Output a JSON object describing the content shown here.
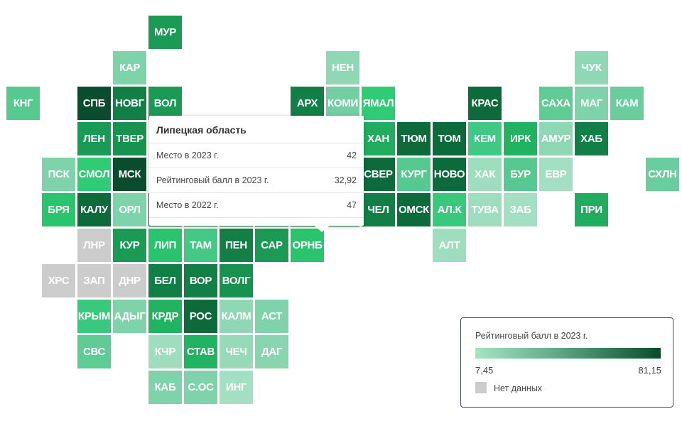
{
  "map": {
    "no_data_color": "#cccccc",
    "tiles": [
      {
        "label": "МУР",
        "color": "#1a9a55"
      },
      {
        "label": "КАР",
        "color": "#7fd3ab"
      },
      {
        "label": "НЕН",
        "color": "#8fd8b5"
      },
      {
        "label": "ЧУК",
        "color": "#8fd8b5"
      },
      {
        "label": "КНГ",
        "color": "#55c98f"
      },
      {
        "label": "СПБ",
        "color": "#0a4d2e"
      },
      {
        "label": "НОВГ",
        "color": "#128046"
      },
      {
        "label": "ВОЛ",
        "color": "#1a9a55"
      },
      {
        "label": "АРХ",
        "color": "#128046"
      },
      {
        "label": "КОМИ",
        "color": "#72cfa2"
      },
      {
        "label": "ЯМАЛ",
        "color": "#2fcc75"
      },
      {
        "label": "КРАС",
        "color": "#0d6a3b"
      },
      {
        "label": "САХА",
        "color": "#5fcb95"
      },
      {
        "label": "МАГ",
        "color": "#7fd3ab"
      },
      {
        "label": "КАМ",
        "color": "#6acd9d"
      },
      {
        "label": "ЛЕН",
        "color": "#1a9a55"
      },
      {
        "label": "ТВЕР",
        "color": "#18934f"
      },
      {
        "label": "ХАН",
        "color": "#21ad5f"
      },
      {
        "label": "ТЮМ",
        "color": "#0d6a3b"
      },
      {
        "label": "ТОМ",
        "color": "#0d6a3b"
      },
      {
        "label": "КЕМ",
        "color": "#40c985"
      },
      {
        "label": "ИРК",
        "color": "#21b362"
      },
      {
        "label": "АМУР",
        "color": "#8fd8b5"
      },
      {
        "label": "ХАБ",
        "color": "#128046"
      },
      {
        "label": "ПСК",
        "color": "#7fd3ab"
      },
      {
        "label": "СМОЛ",
        "color": "#2fcc75"
      },
      {
        "label": "МСК",
        "color": "#0a4d2e"
      },
      {
        "label": "СВЕР",
        "color": "#0d6a3b"
      },
      {
        "label": "КУРГ",
        "color": "#55c98f"
      },
      {
        "label": "НОВО",
        "color": "#0d6a3b"
      },
      {
        "label": "ХАК",
        "color": "#9edebf"
      },
      {
        "label": "БУР",
        "color": "#55c98f"
      },
      {
        "label": "ЕВР",
        "color": "#a3dfc2"
      },
      {
        "label": "СХЛН",
        "color": "#6acd9d"
      },
      {
        "label": "БРЯ",
        "color": "#29c46d"
      },
      {
        "label": "КАЛУ",
        "color": "#0d6a3b"
      },
      {
        "label": "ОРЛ",
        "color": "#7fd3ab"
      },
      {
        "label": "",
        "color": "#0e6e3e"
      },
      {
        "label": "",
        "color": "#128046"
      },
      {
        "label": "",
        "color": "#128046"
      },
      {
        "label": "",
        "color": "#128046"
      },
      {
        "label": "",
        "color": "#0e6e3e"
      },
      {
        "label": "",
        "color": "#128046"
      },
      {
        "label": "ЧЕЛ",
        "color": "#128046"
      },
      {
        "label": "ОМСК",
        "color": "#0d6a3b"
      },
      {
        "label": "АЛ.К",
        "color": "#38c97d"
      },
      {
        "label": "ТУВА",
        "color": "#9edebf"
      },
      {
        "label": "ЗАБ",
        "color": "#a3dfc2"
      },
      {
        "label": "ПРИ",
        "color": "#21ad5f"
      },
      {
        "label": "ЛНР",
        "color": "#cccccc"
      },
      {
        "label": "КУР",
        "color": "#1a9a55"
      },
      {
        "label": "ЛИП",
        "color": "#29c46d"
      },
      {
        "label": "ТАМ",
        "color": "#45c886"
      },
      {
        "label": "ПЕН",
        "color": "#128046"
      },
      {
        "label": "САР",
        "color": "#1a9a55"
      },
      {
        "label": "ОРНБ",
        "color": "#29c46d"
      },
      {
        "label": "АЛТ",
        "color": "#9edebf"
      },
      {
        "label": "ХРС",
        "color": "#cccccc"
      },
      {
        "label": "ЗАП",
        "color": "#cccccc"
      },
      {
        "label": "ДНР",
        "color": "#cccccc"
      },
      {
        "label": "БЕЛ",
        "color": "#128046"
      },
      {
        "label": "ВОР",
        "color": "#128046"
      },
      {
        "label": "ВОЛГ",
        "color": "#18934f"
      },
      {
        "label": "КРЫМ",
        "color": "#38c97d"
      },
      {
        "label": "АДЫГ",
        "color": "#7fd3ab"
      },
      {
        "label": "КРДР",
        "color": "#21b362"
      },
      {
        "label": "РОС",
        "color": "#0d6a3b"
      },
      {
        "label": "КАЛМ",
        "color": "#8fd8b5"
      },
      {
        "label": "АСТ",
        "color": "#7fd3ab"
      },
      {
        "label": "СВС",
        "color": "#5fcb95"
      },
      {
        "label": "КЧР",
        "color": "#9edebf"
      },
      {
        "label": "СТАВ",
        "color": "#21b362"
      },
      {
        "label": "ЧЕЧ",
        "color": "#95dab9"
      },
      {
        "label": "ДАГ",
        "color": "#88d6b0"
      },
      {
        "label": "КАБ",
        "color": "#7fd3ab"
      },
      {
        "label": "С.ОС",
        "color": "#7fd3ab"
      },
      {
        "label": "ИНГ",
        "color": "#a3dfc2"
      }
    ]
  },
  "tooltip": {
    "title": "Липецкая область",
    "rows": [
      {
        "label": "Место в 2023 г.",
        "value": "42"
      },
      {
        "label": "Рейтинговый балл в 2023 г.",
        "value": "32,92"
      },
      {
        "label": "Место в 2022 г.",
        "value": "47"
      }
    ]
  },
  "legend": {
    "title": "Рейтинговый балл в 2023 г.",
    "min": "7,45",
    "max": "81,15",
    "color_min": "#a8e3c6",
    "color_max": "#0a4a2c",
    "no_data_label": "Нет данных"
  }
}
